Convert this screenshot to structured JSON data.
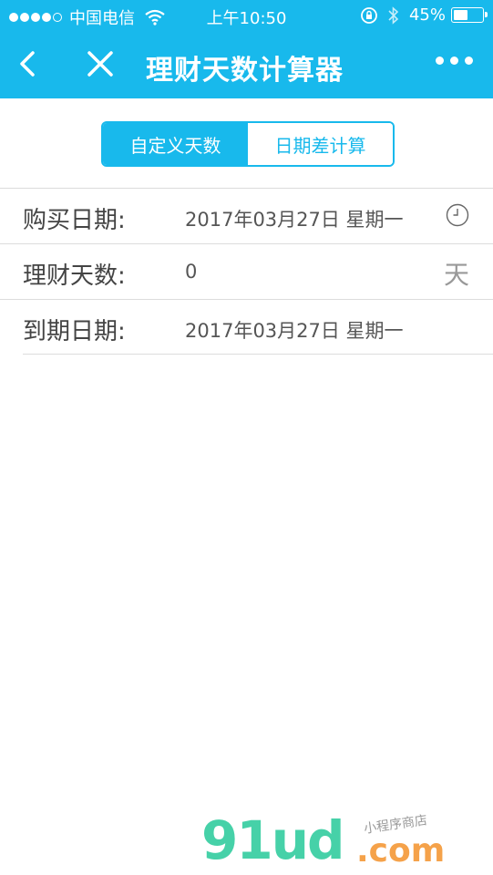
{
  "status_bar": {
    "carrier": "中国电信",
    "time": "上午10:50",
    "battery": "45%",
    "battery_level": 0.45
  },
  "nav": {
    "title": "理财天数计算器"
  },
  "segment": {
    "options": [
      "自定义天数",
      "日期差计算"
    ],
    "selected": 0
  },
  "form": {
    "rows": [
      {
        "label": "购买日期:",
        "value": "2017年03月27日 星期一",
        "icon": "clock-icon"
      },
      {
        "label": "理财天数:",
        "value": "0",
        "unit": "天"
      },
      {
        "label": "到期日期:",
        "value": "2017年03月27日 星期一"
      }
    ]
  },
  "watermark": {
    "brand": "91ud",
    "tld": ".com",
    "caption": "小程序商店"
  },
  "colors": {
    "accent": "#18b9ec",
    "watermark_green": "#46d1a8",
    "watermark_orange": "#f5a24a"
  }
}
